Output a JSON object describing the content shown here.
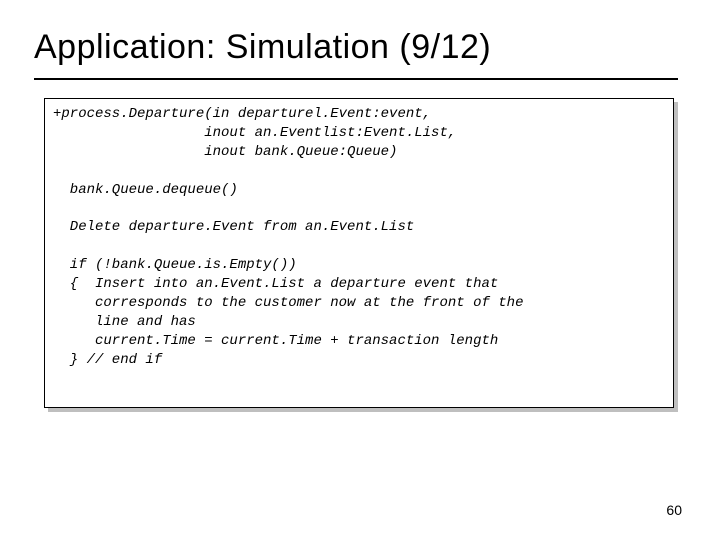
{
  "slide": {
    "title": "Application: Simulation (9/12)",
    "page_number": "60"
  },
  "code": {
    "sig1": "+process.Departure(in departurel.Event:event,",
    "sig2": "                  inout an.Eventlist:Event.List,",
    "sig3": "                  inout bank.Queue:Queue)",
    "blank1": "",
    "l1": "  bank.Queue.dequeue()",
    "blank2": "",
    "l2": "  Delete departure.Event from an.Event.List",
    "blank3": "",
    "l3": "  if (!bank.Queue.is.Empty())",
    "l4": "  {  Insert into an.Event.List a departure event that",
    "l5": "     corresponds to the customer now at the front of the",
    "l6": "     line and has",
    "l7": "     current.Time = current.Time + transaction length",
    "l8": "  } // end if"
  }
}
